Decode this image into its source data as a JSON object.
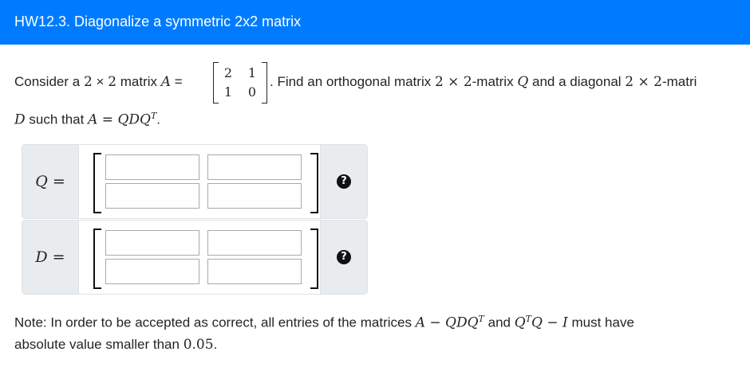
{
  "header": {
    "title": "HW12.3. Diagonalize a symmetric 2x2 matrix"
  },
  "problem": {
    "consider": "Consider a",
    "two1": "2",
    "times1": "×",
    "two2": "2",
    "matrix_word": "matrix",
    "A": "A",
    "eq": "=",
    "matrix_A": [
      "2",
      "1",
      "1",
      "0"
    ],
    "find": ". Find an orthogonal matrix",
    "dim1": "2 × 2",
    "matrix_dash": "-matrix",
    "Q": "Q",
    "and_diag": "and a diagonal",
    "dim2": "2 × 2",
    "matri": "-matri",
    "D": "D",
    "such_that": "such that",
    "equation": "A = QDQ",
    "T": "T",
    "period": "."
  },
  "groups": [
    {
      "label": "Q =",
      "help": "?"
    },
    {
      "label": "D =",
      "help": "?"
    }
  ],
  "note": {
    "prefix": "Note: In order to be accepted as correct, all entries of the matrices",
    "expr1": "A − QDQ",
    "expr1_sup": "T",
    "and": "and",
    "expr2a": "Q",
    "expr2_sup": "T",
    "expr2b": "Q − I",
    "suffix": "must have",
    "line2_prefix": "absolute value smaller than",
    "threshold": "0.05",
    "period": "."
  }
}
